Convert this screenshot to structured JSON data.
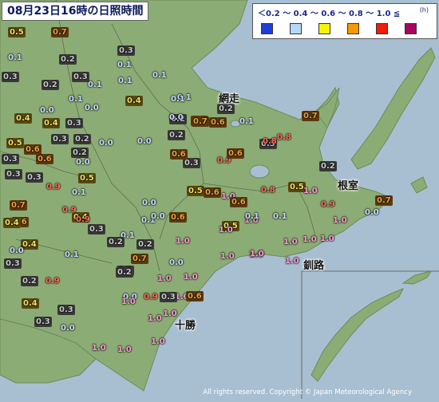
{
  "title": "08月23日16時の日照時間",
  "legend": {
    "labels": "＜0.2 〜 0.4 〜 0.6 〜 0.8 〜 1.0 ≦",
    "unit": "(h)",
    "swatches": [
      {
        "name": "swatch-below-0.2",
        "color": "#1f3fd6"
      },
      {
        "name": "swatch-0.2-0.4",
        "color": "#b4d8ff"
      },
      {
        "name": "swatch-0.4-0.6",
        "color": "#f6f600"
      },
      {
        "name": "swatch-0.6-0.8",
        "color": "#f79800"
      },
      {
        "name": "swatch-0.8-1.0",
        "color": "#ef1c09"
      },
      {
        "name": "swatch-1.0-above",
        "color": "#aa055e"
      }
    ]
  },
  "colors": {
    "water": "#a8bfd2",
    "land": "#8cac75",
    "mountain": "#7d9d68",
    "boundary": "#5a6f4c",
    "value_grey": "#c8c8c8",
    "value_blue": "#c8dcff",
    "value_yellow": "#f0e060",
    "value_orange": "#f0a040",
    "value_red": "#ff6a5a",
    "value_magenta": "#ff9ad6"
  },
  "places": [
    {
      "name": "abashiri",
      "label": "網走"
    },
    {
      "name": "nemuro",
      "label": "根室"
    },
    {
      "name": "kushiro",
      "label": "釧路"
    },
    {
      "name": "tokachi",
      "label": "十勝"
    }
  ],
  "stations": [
    {
      "v": "0.5",
      "c": "yellow"
    },
    {
      "v": "0.7",
      "c": "orange"
    },
    {
      "v": "0.1",
      "c": "blue"
    },
    {
      "v": "0.3",
      "c": "grey"
    },
    {
      "v": "0.3",
      "c": "grey"
    },
    {
      "v": "0.2",
      "c": "grey"
    },
    {
      "v": "0.1",
      "c": "blue"
    },
    {
      "v": "0.3",
      "c": "grey"
    },
    {
      "v": "0.1",
      "c": "blue"
    },
    {
      "v": "0.2",
      "c": "grey"
    },
    {
      "v": "0.1",
      "c": "blue"
    },
    {
      "v": "0.1",
      "c": "blue"
    },
    {
      "v": "0.1",
      "c": "blue"
    },
    {
      "v": "0.4",
      "c": "yellow"
    },
    {
      "v": "0.0",
      "c": "blue"
    },
    {
      "v": "0.1",
      "c": "blue"
    },
    {
      "v": "0.0",
      "c": "blue"
    },
    {
      "v": "0.4",
      "c": "yellow"
    },
    {
      "v": "0.4",
      "c": "yellow"
    },
    {
      "v": "0.3",
      "c": "grey"
    },
    {
      "v": "0.2",
      "c": "grey"
    },
    {
      "v": "0.5",
      "c": "yellow"
    },
    {
      "v": "0.3",
      "c": "grey"
    },
    {
      "v": "0.2",
      "c": "grey"
    },
    {
      "v": "0.0",
      "c": "blue"
    },
    {
      "v": "0.6",
      "c": "orange"
    },
    {
      "v": "0.3",
      "c": "grey"
    },
    {
      "v": "0.2",
      "c": "grey"
    },
    {
      "v": "0.0",
      "c": "blue"
    },
    {
      "v": "0.6",
      "c": "orange"
    },
    {
      "v": "0.0",
      "c": "blue"
    },
    {
      "v": "0.2",
      "c": "grey"
    },
    {
      "v": "0.3",
      "c": "grey"
    },
    {
      "v": "0.3",
      "c": "grey"
    },
    {
      "v": "0.5",
      "c": "yellow"
    },
    {
      "v": "0.6",
      "c": "orange"
    },
    {
      "v": "0.9",
      "c": "red"
    },
    {
      "v": "0.1",
      "c": "blue"
    },
    {
      "v": "0.7",
      "c": "orange"
    },
    {
      "v": "0.6",
      "c": "orange"
    },
    {
      "v": "0.9",
      "c": "red"
    },
    {
      "v": "0.9",
      "c": "red"
    },
    {
      "v": "0.3",
      "c": "grey"
    },
    {
      "v": "0.4",
      "c": "yellow"
    },
    {
      "v": "0.0",
      "c": "blue"
    },
    {
      "v": "0.4",
      "c": "yellow"
    },
    {
      "v": "0.4",
      "c": "yellow"
    },
    {
      "v": "0.3",
      "c": "grey"
    },
    {
      "v": "0.6",
      "c": "orange"
    },
    {
      "v": "0.5",
      "c": "yellow"
    },
    {
      "v": "0.6",
      "c": "orange"
    },
    {
      "v": "0.8",
      "c": "red"
    },
    {
      "v": "0.1",
      "c": "blue"
    },
    {
      "v": "0.2",
      "c": "grey"
    },
    {
      "v": "0.1",
      "c": "blue"
    },
    {
      "v": "0.0",
      "c": "blue"
    },
    {
      "v": "0.7",
      "c": "orange"
    },
    {
      "v": "0.3",
      "c": "grey"
    },
    {
      "v": "0.7",
      "c": "orange"
    },
    {
      "v": "0.2",
      "c": "grey"
    },
    {
      "v": "0.1",
      "c": "blue"
    },
    {
      "v": "0.9",
      "c": "red"
    },
    {
      "v": "0.0",
      "c": "blue"
    },
    {
      "v": "0.1",
      "c": "blue"
    },
    {
      "v": "0.0",
      "c": "blue"
    },
    {
      "v": "0.1",
      "c": "blue"
    },
    {
      "v": "0.2",
      "c": "grey"
    },
    {
      "v": "0.2",
      "c": "grey"
    },
    {
      "v": "0.6",
      "c": "orange"
    },
    {
      "v": "0.3",
      "c": "grey"
    },
    {
      "v": "0.3",
      "c": "grey"
    },
    {
      "v": "0.2",
      "c": "grey"
    },
    {
      "v": "0.4",
      "c": "yellow"
    },
    {
      "v": "0.6",
      "c": "orange"
    },
    {
      "v": "0.9",
      "c": "red"
    },
    {
      "v": "0.5",
      "c": "yellow"
    },
    {
      "v": "0.3",
      "c": "grey"
    },
    {
      "v": "0.2",
      "c": "grey"
    },
    {
      "v": "0.0",
      "c": "blue"
    },
    {
      "v": "0.0",
      "c": "blue"
    },
    {
      "v": "0.7",
      "c": "orange"
    },
    {
      "v": "1.0",
      "c": "magenta"
    },
    {
      "v": "0.9",
      "c": "red"
    },
    {
      "v": "1.0",
      "c": "magenta"
    },
    {
      "v": "1.0",
      "c": "magenta"
    },
    {
      "v": "1.0",
      "c": "magenta"
    },
    {
      "v": "1.0",
      "c": "magenta"
    },
    {
      "v": "1.0",
      "c": "magenta"
    },
    {
      "v": "1.0",
      "c": "magenta"
    },
    {
      "v": "1.0",
      "c": "magenta"
    },
    {
      "v": "1.0",
      "c": "magenta"
    },
    {
      "v": "0.2",
      "c": "grey"
    },
    {
      "v": "0.6",
      "c": "orange"
    },
    {
      "v": "0.8",
      "c": "red"
    },
    {
      "v": "0.0",
      "c": "blue"
    },
    {
      "v": "0.3",
      "c": "grey"
    },
    {
      "v": "0.6",
      "c": "orange"
    },
    {
      "v": "0.6",
      "c": "orange"
    },
    {
      "v": "0.5",
      "c": "yellow"
    },
    {
      "v": "1.0",
      "c": "magenta"
    },
    {
      "v": "0.9",
      "c": "red"
    },
    {
      "v": "1.0",
      "c": "magenta"
    },
    {
      "v": "0.7",
      "c": "orange"
    },
    {
      "v": "0.0",
      "c": "blue"
    },
    {
      "v": "1.0",
      "c": "magenta"
    },
    {
      "v": "1.0",
      "c": "magenta"
    },
    {
      "v": "1.0",
      "c": "magenta"
    },
    {
      "v": "1.0",
      "c": "magenta"
    },
    {
      "v": "1.0",
      "c": "magenta"
    },
    {
      "v": "1.0",
      "c": "magenta"
    },
    {
      "v": "0.1",
      "c": "blue"
    },
    {
      "v": "0.8",
      "c": "red"
    },
    {
      "v": "0.1",
      "c": "blue"
    },
    {
      "v": "1.0",
      "c": "magenta"
    },
    {
      "v": "1.0",
      "c": "magenta"
    },
    {
      "v": "1.0",
      "c": "magenta"
    },
    {
      "v": "1.0",
      "c": "magenta"
    },
    {
      "v": "1.0",
      "c": "magenta"
    }
  ],
  "copyright": "All rights reserved. Copyright © Japan Meteorological Agency"
}
